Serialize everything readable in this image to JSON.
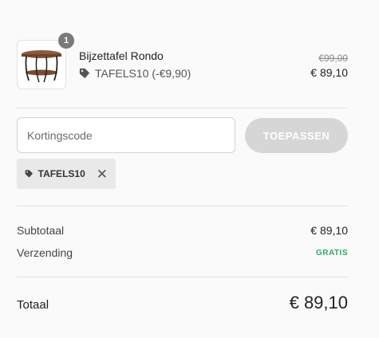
{
  "cart": {
    "item": {
      "name": "Bijzettafel Rondo",
      "quantity": "1",
      "discount_text": "TAFELS10 (-€9,90)",
      "old_price": "€99,00",
      "price": "€ 89,10"
    }
  },
  "coupon": {
    "placeholder": "Kortingscode",
    "value": "",
    "apply_label": "TOEPASSEN",
    "applied_code": "TAFELS10"
  },
  "summary": {
    "subtotal_label": "Subtotaal",
    "subtotal_value": "€ 89,10",
    "shipping_label": "Verzending",
    "shipping_value": "GRATIS",
    "total_label": "Totaal",
    "total_value": "€ 89,10"
  },
  "colors": {
    "free_shipping": "#3aa56a",
    "apply_button": "#d6d6d6",
    "badge": "#7a7a7a"
  }
}
